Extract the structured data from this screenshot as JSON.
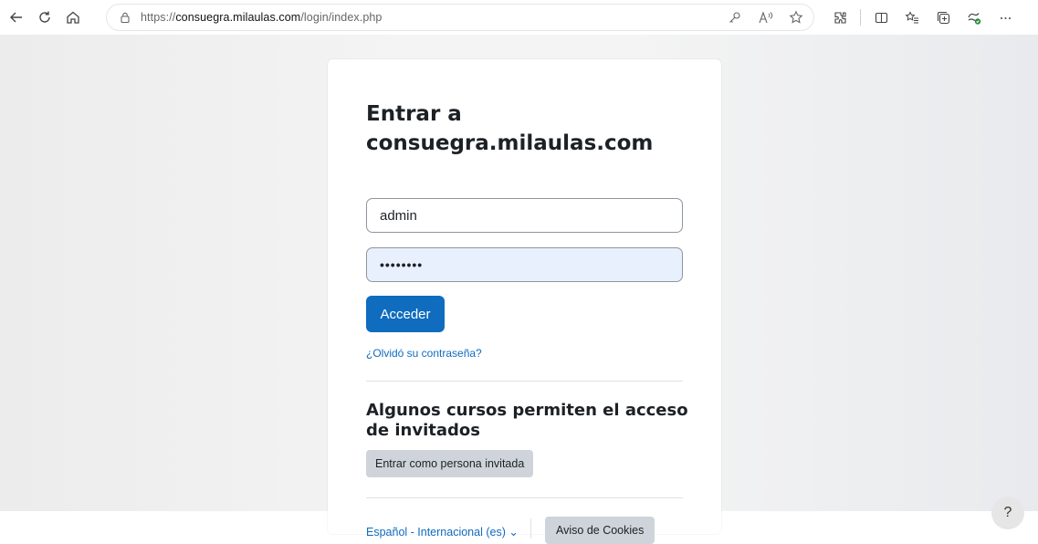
{
  "browser": {
    "url_scheme": "https://",
    "url_host": "consuegra.milaulas.com",
    "url_path": "/login/index.php",
    "icons": [
      "back-icon",
      "refresh-icon",
      "home-icon",
      "lock-icon",
      "passkey-icon",
      "read-aloud-icon",
      "favorite-star-icon",
      "extensions-icon",
      "split-screen-icon",
      "favorites-icon",
      "collections-icon",
      "browser-essentials-icon",
      "more-icon"
    ]
  },
  "login": {
    "title": "Entrar a consuegra.milaulas.com",
    "username_value": "admin",
    "password_value": "••••••••",
    "submit_label": "Acceder",
    "forgot_label": "¿Olvidó su contraseña?"
  },
  "guest": {
    "title": "Algunos cursos permiten el acceso de invitados",
    "button_label": "Entrar como persona invitada"
  },
  "footer": {
    "language_label": "Español - Internacional (es) ⌄",
    "cookies_label": "Aviso de Cookies",
    "help_label": "?"
  },
  "colors": {
    "primary": "#0f6cbf",
    "secondary": "#ced4da",
    "autofill": "#e8f0fe"
  }
}
